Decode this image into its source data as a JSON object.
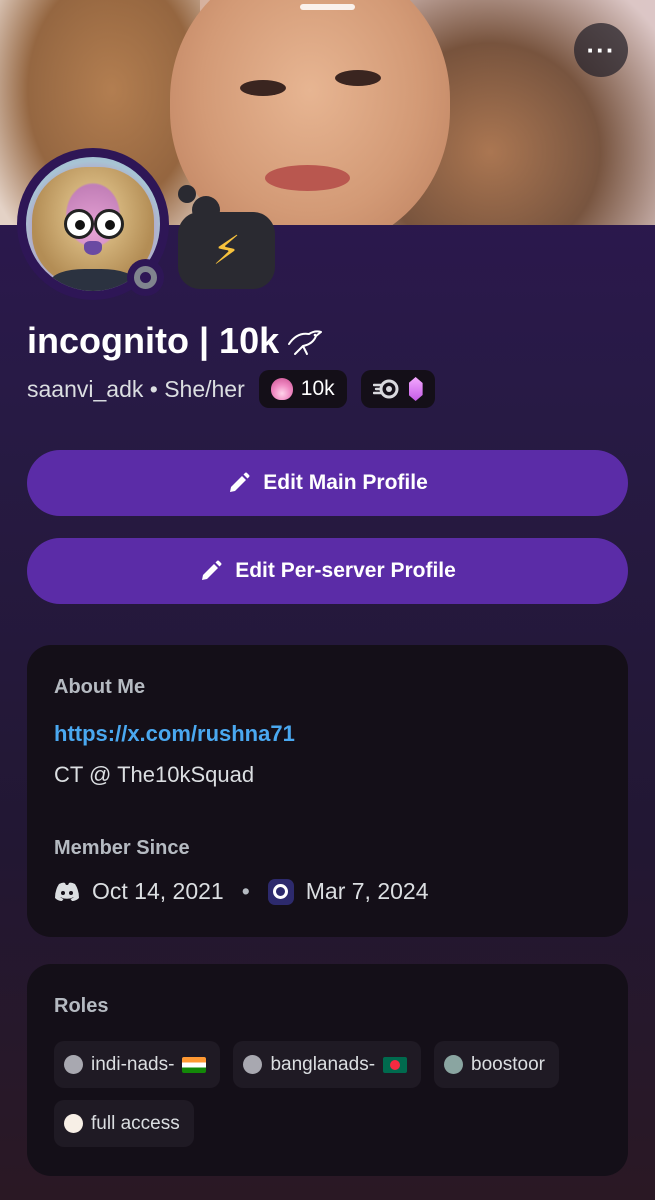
{
  "profile": {
    "display_name": "incognito | 10k",
    "username": "saanvi_adk",
    "separator": "•",
    "pronouns": "She/her",
    "status_emoji": "⚡",
    "more_label": "···",
    "status_color": "#80848e",
    "accent_color": "#5b2ca7"
  },
  "badges": {
    "guild_tag_label": "10k",
    "guild_tag_icon": "flame-icon",
    "nitro_icon": "nitro-swirl-icon",
    "boost_icon": "gem-icon"
  },
  "buttons": {
    "edit_main": "Edit Main Profile",
    "edit_server": "Edit Per-server Profile"
  },
  "about": {
    "label": "About Me",
    "link": "https://x.com/rushna71",
    "text": "CT @ The10kSquad"
  },
  "member_since": {
    "label": "Member Since",
    "discord_date": "Oct 14, 2021",
    "separator": "•",
    "server_date": "Mar 7, 2024"
  },
  "roles": {
    "label": "Roles",
    "items": [
      {
        "name": "indi-nads-",
        "color": "#a8a8b0",
        "flag": "in"
      },
      {
        "name": "banglanads-",
        "color": "#a8a8b0",
        "flag": "bd"
      },
      {
        "name": "boostoor",
        "color": "#8aa5a1",
        "flag": ""
      },
      {
        "name": "full access",
        "color": "#f7efe6",
        "flag": ""
      }
    ]
  }
}
